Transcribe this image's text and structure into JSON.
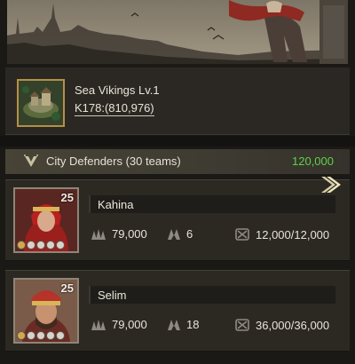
{
  "city": {
    "name": "Sea Vikings Lv.1",
    "coords": "K178:(810,976)"
  },
  "defenders": {
    "title": "City Defenders (30 teams)",
    "value": "120,000"
  },
  "teams": [
    {
      "hero": "Kahina",
      "level": "25",
      "troops": "79,000",
      "count": "6",
      "hp": "12,000/12,000"
    },
    {
      "hero": "Selim",
      "level": "25",
      "troops": "79,000",
      "count": "18",
      "hp": "36,000/36,000"
    }
  ],
  "colors": {
    "accent_green": "#5fd04a",
    "gold_border": "#b39145"
  },
  "icons": [
    "shield-v-icon",
    "chevron-right-icon",
    "troop-icon",
    "unit-icon",
    "hp-icon"
  ]
}
